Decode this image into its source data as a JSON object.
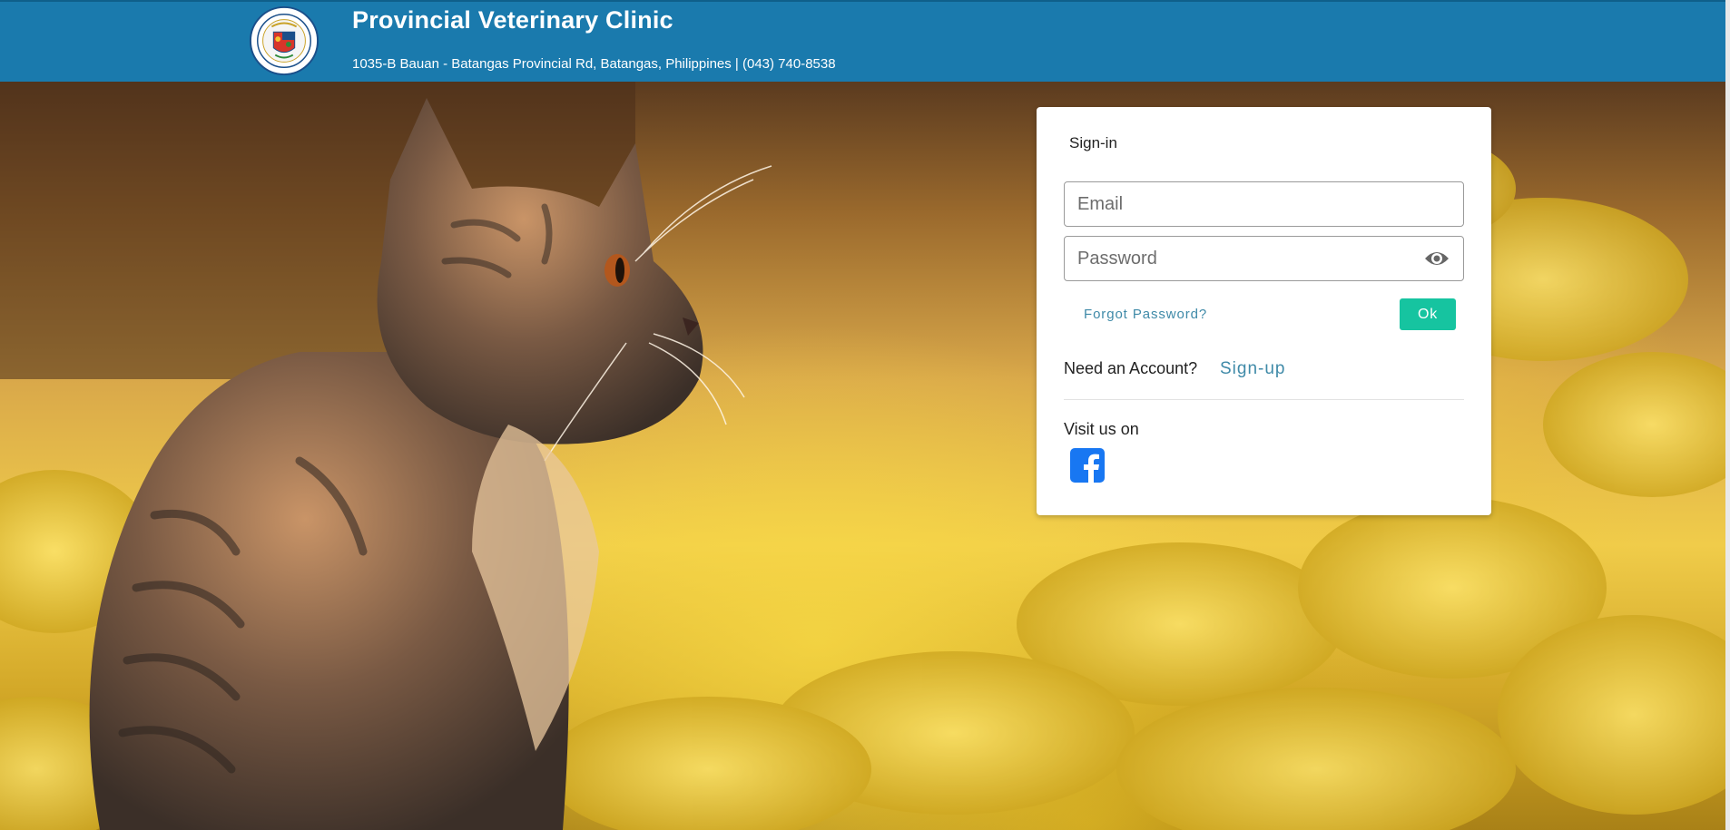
{
  "header": {
    "title": "Provincial Veterinary Clinic",
    "address": "1035-B Bauan - Batangas Provincial Rd, Batangas, Philippines | (043) 740-8538",
    "logo_icon": "provincial-seal-logo",
    "background_color": "#1a7aad"
  },
  "signin": {
    "title": "Sign-in",
    "email_placeholder": "Email",
    "password_placeholder": "Password",
    "show_password_icon": "eye-icon",
    "forgot_password": "Forgot Password?",
    "ok_label": "Ok",
    "need_account": "Need an Account?",
    "signup_label": "Sign-up",
    "visit_label": "Visit us on",
    "social_icon": "facebook-icon"
  },
  "colors": {
    "accent": "#16c4a0",
    "link": "#3f8aa8",
    "facebook": "#1877f2"
  }
}
